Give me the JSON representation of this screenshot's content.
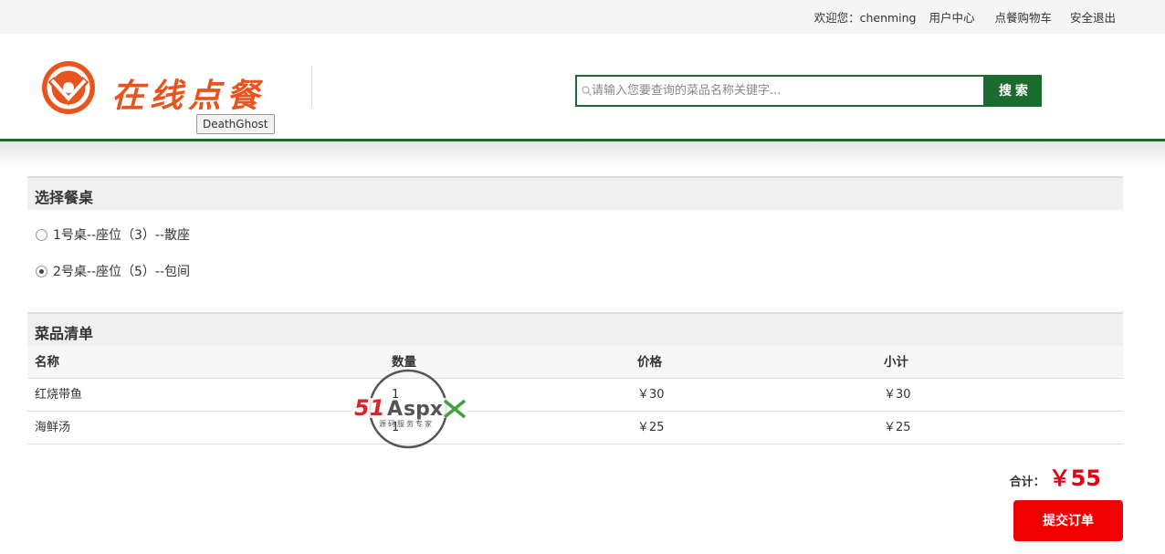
{
  "topbar": {
    "welcome": "欢迎您：chenming",
    "user_center": "用户中心",
    "cart": "点餐购物车",
    "logout": "安全退出"
  },
  "header": {
    "logo_text": "在线点餐",
    "logo_tooltip": "DeathGhost",
    "brand_color": "#e8541e",
    "accent_color": "#1b6b2f"
  },
  "search": {
    "placeholder": "请输入您要查询的菜品名称关键字...",
    "value": "",
    "button_label": "搜 索"
  },
  "table_section": {
    "title": "选择餐桌",
    "options": [
      {
        "label": "1号桌--座位（3）--散座",
        "checked": false
      },
      {
        "label": "2号桌--座位（5）--包间",
        "checked": true
      }
    ]
  },
  "dishes_section": {
    "title": "菜品清单",
    "columns": [
      "名称",
      "数量",
      "价格",
      "小计"
    ],
    "rows": [
      {
        "name": "红烧带鱼",
        "qty": "1",
        "price": "￥30",
        "subtotal": "￥30"
      },
      {
        "name": "海鲜汤",
        "qty": "1",
        "price": "￥25",
        "subtotal": "￥25"
      }
    ]
  },
  "watermark": {
    "brand": "51Aspx",
    "tagline": "源码服务专家"
  },
  "order": {
    "total_label": "合计：",
    "total_value": "￥55",
    "submit_label": "提交订单",
    "submit_color": "#f00000"
  }
}
